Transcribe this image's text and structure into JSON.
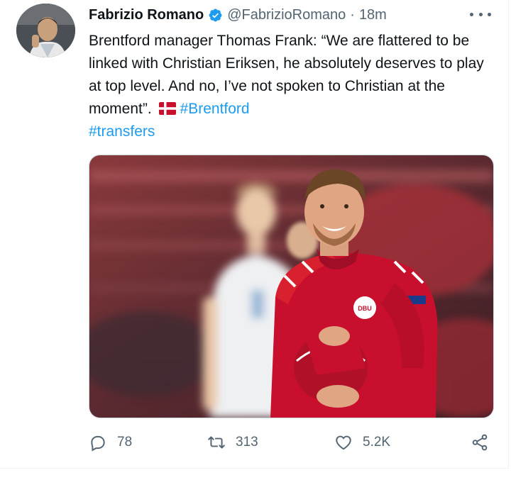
{
  "tweet": {
    "author_name": "Fabrizio Romano",
    "handle": "@FabrizioRomano",
    "separator": "·",
    "time": "18m",
    "text_part1": "Brentford manager Thomas Frank: “We are flattered to be linked with Christian Eriksen, he absolutely deserves to play at top level. And no, I’ve not spoken to Christian at the moment”.",
    "hashtag1": "#Brentford",
    "hashtag2": "#transfers"
  },
  "actions": {
    "replies": "78",
    "retweets": "313",
    "likes": "5.2K"
  },
  "icons": {
    "verified": "verified-badge-icon",
    "more": "more-options-icon",
    "reply": "reply-icon",
    "retweet": "retweet-icon",
    "like": "heart-icon",
    "share": "share-icon"
  },
  "colors": {
    "accent": "#1d9bf0",
    "secondary_text": "#536471",
    "jersey_red": "#c8102e"
  }
}
